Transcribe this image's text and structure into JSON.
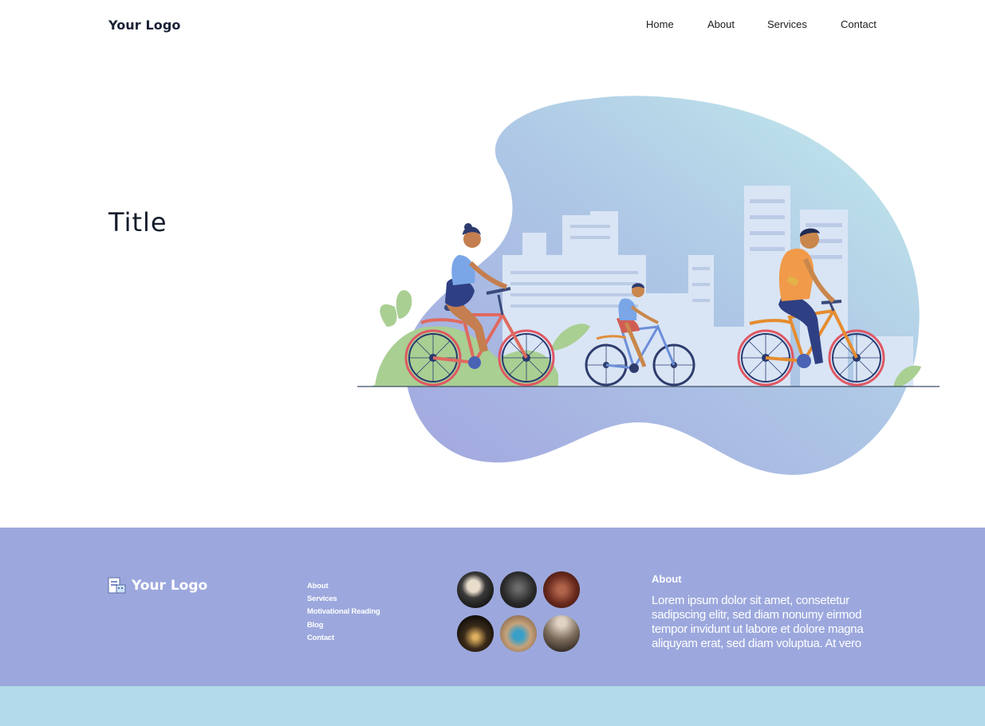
{
  "header": {
    "logo": "Your Logo",
    "nav": [
      "Home",
      "About",
      "Services",
      "Contact"
    ]
  },
  "hero": {
    "title": "Title",
    "illustration": "people-cycling-city-illustration"
  },
  "footer": {
    "logo": "Your Logo",
    "links": [
      "About",
      "Services",
      "Motivational Reading",
      "Blog",
      "Contact"
    ],
    "gallery_count": 6,
    "about_heading": "About",
    "about_text": "Lorem ipsum dolor sit amet, consetetur sadipscing elitr, sed diam nonumy eirmod tempor invidunt ut labore et dolore magna aliquyam erat, sed diam voluptua. At vero"
  },
  "colors": {
    "footer_bg": "#9ca8dd",
    "bottom_band": "#b2daea",
    "blob_start": "#a4aadf",
    "blob_end": "#bfe9ec"
  }
}
